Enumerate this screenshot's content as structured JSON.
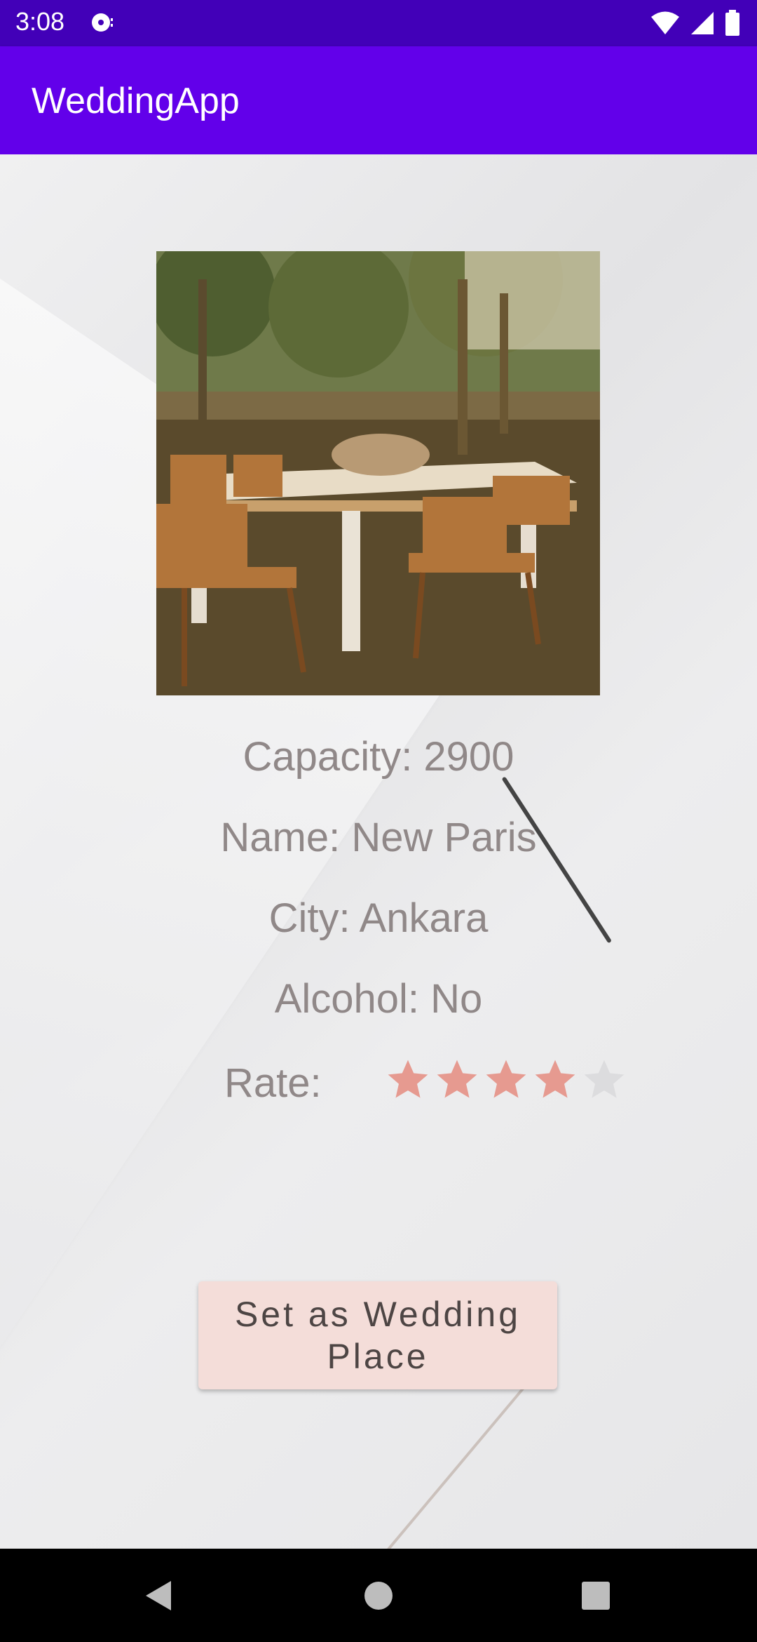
{
  "status_bar": {
    "time": "3:08"
  },
  "app_bar": {
    "title": "WeddingApp"
  },
  "venue": {
    "capacity_text": "Capacity: 2900",
    "name_text": "Name: New Paris",
    "city_text": "City: Ankara",
    "alcohol_text": "Alcohol: No",
    "rate_label": "Rate:",
    "rating": {
      "value": 4,
      "max": 5
    }
  },
  "actions": {
    "set_wedding_place_label": "Set as Wedding Place"
  },
  "colors": {
    "status_bar": "#4200b8",
    "app_bar": "#6200ea",
    "star_filled": "#e69a90",
    "star_empty": "#dcdcde",
    "button_bg": "#f4ddd9"
  },
  "icons": {
    "notification": "media-notification-icon",
    "wifi": "wifi-icon",
    "signal": "signal-icon",
    "battery": "battery-icon",
    "back": "back-icon",
    "home": "home-icon",
    "recents": "recents-icon"
  }
}
